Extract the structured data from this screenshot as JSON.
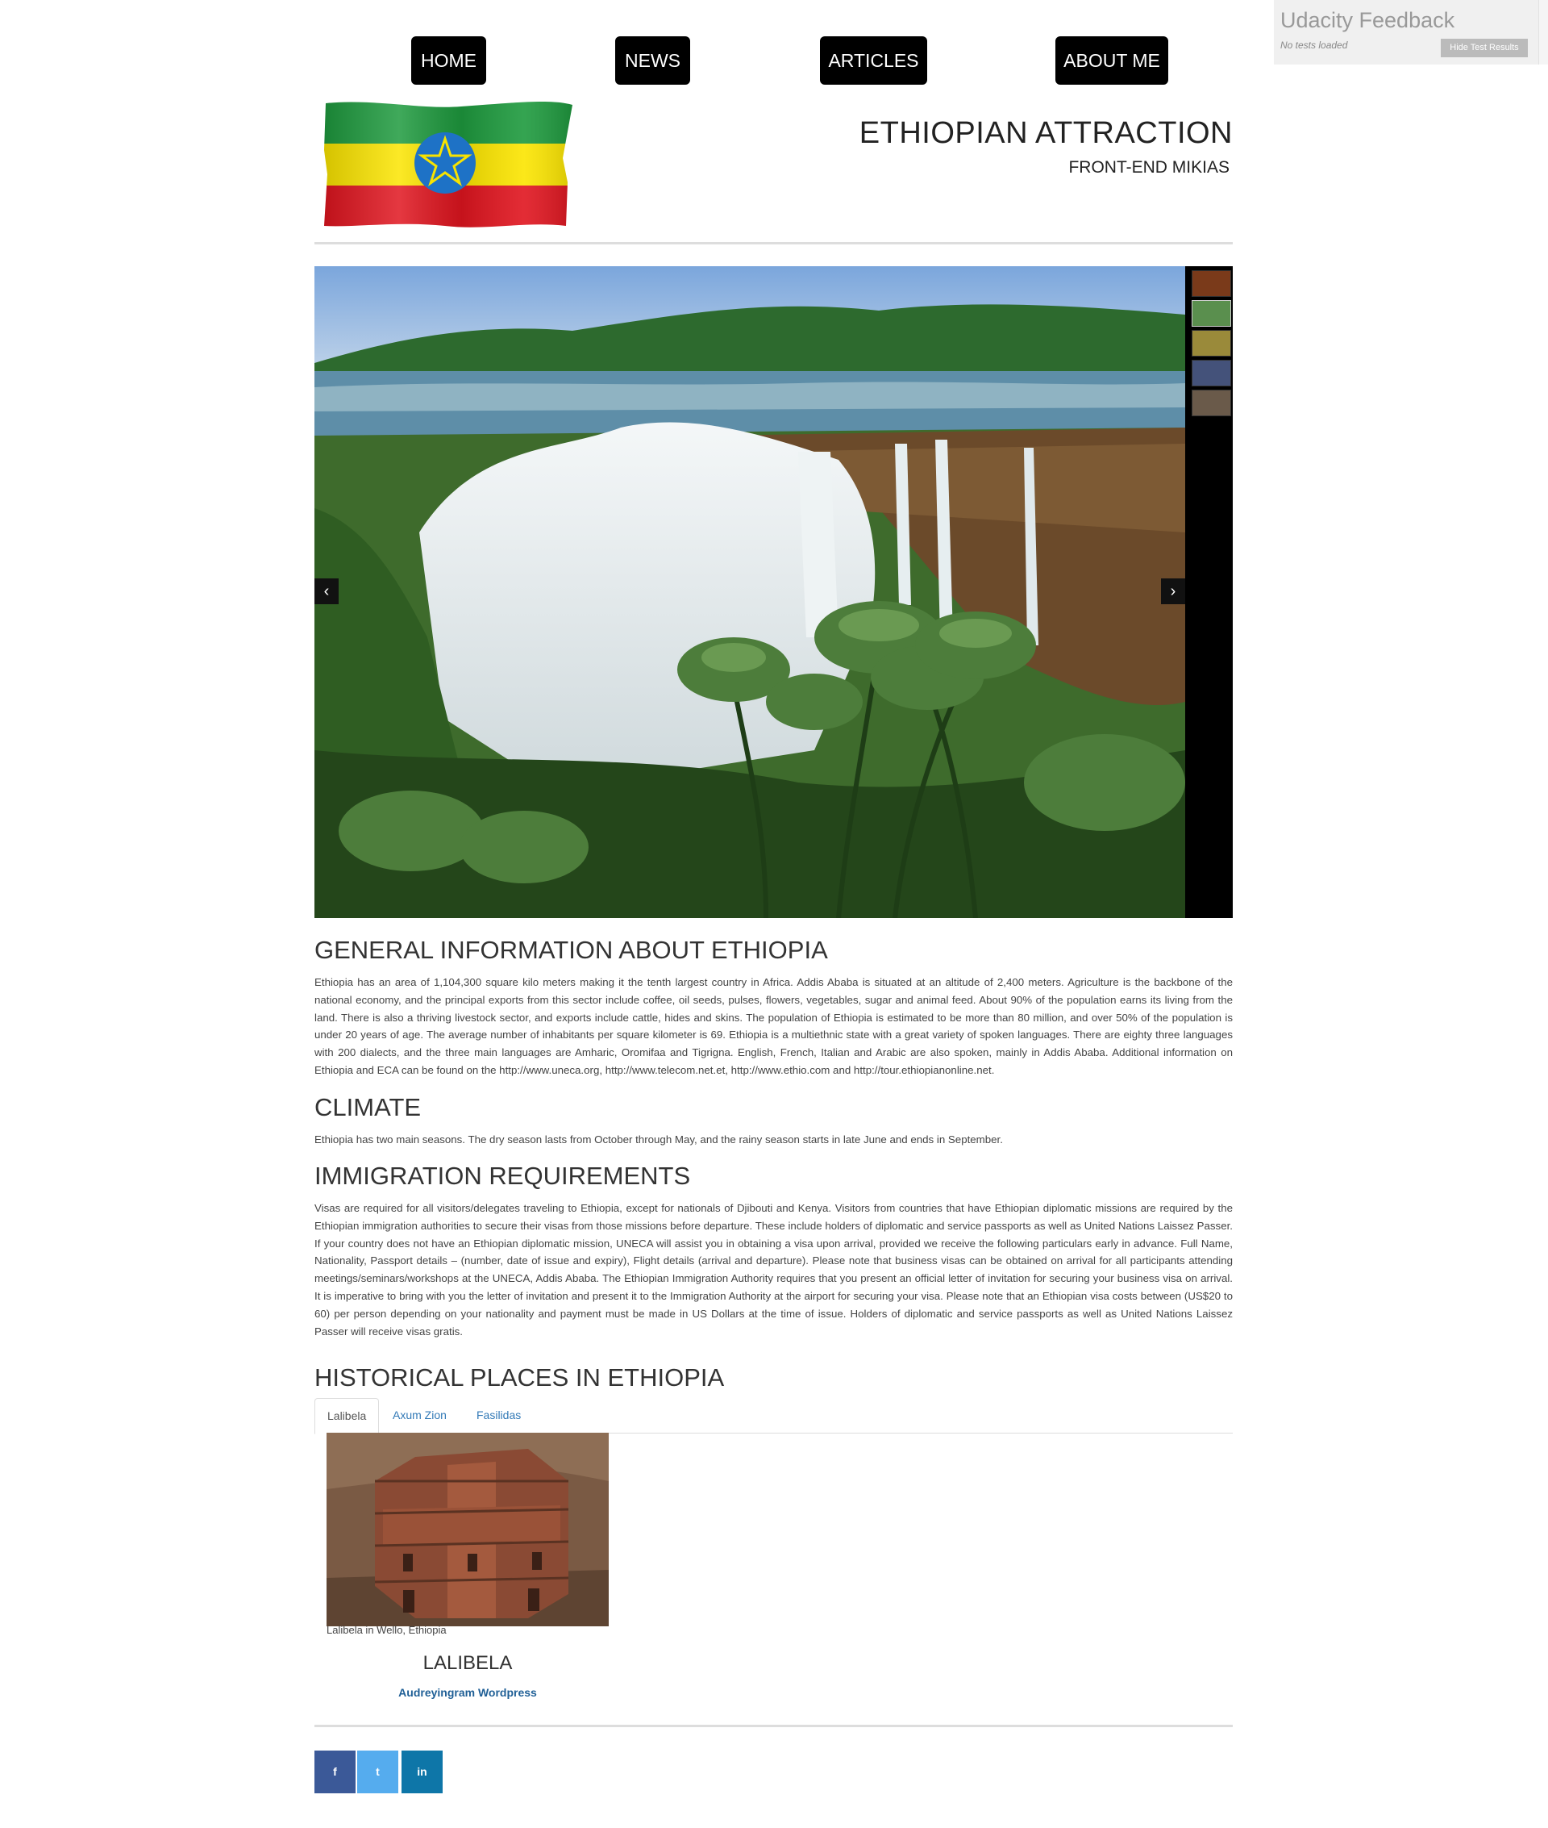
{
  "nav": {
    "items": [
      {
        "label": "HOME"
      },
      {
        "label": "NEWS"
      },
      {
        "label": "ARTICLES"
      },
      {
        "label": "ABOUT ME"
      }
    ]
  },
  "header": {
    "title": "ETHIOPIAN ATTRACTION",
    "subtitle": "FRONT-END MIKIAS"
  },
  "carousel": {
    "prev_icon": "‹",
    "next_icon": "›"
  },
  "sections": {
    "general": {
      "heading": "GENERAL INFORMATION ABOUT ETHIOPIA",
      "text": "Ethiopia has an area of 1,104,300 square kilo meters making it the tenth largest country in Africa. Addis Ababa is situated at an altitude of 2,400 meters. Agriculture is the backbone of the national economy, and the principal exports from this sector include coffee, oil seeds, pulses, flowers, vegetables, sugar and animal feed. About 90% of the population earns its living from the land. There is also a thriving livestock sector, and exports include cattle, hides and skins. The population of Ethiopia is estimated to be more than 80 million, and over 50% of the population is under 20 years of age. The average number of inhabitants per square kilometer is 69. Ethiopia is a multiethnic state with a great variety of spoken languages. There are eighty three languages with 200 dialects, and the three main languages are Amharic, Oromifaa and Tigrigna. English, French, Italian and Arabic are also spoken, mainly in Addis Ababa. Additional information on Ethiopia and ECA can be found on the http://www.uneca.org, http://www.telecom.net.et, http://www.ethio.com and http://tour.ethiopianonline.net."
    },
    "climate": {
      "heading": "CLIMATE",
      "text": "Ethiopia has two main seasons. The dry season lasts from October through May, and the rainy season starts in late June and ends in September."
    },
    "immigration": {
      "heading": "IMMIGRATION REQUIREMENTS",
      "text": "Visas are required for all visitors/delegates traveling to Ethiopia, except for nationals of Djibouti and Kenya. Visitors from countries that have Ethiopian diplomatic missions are required by the Ethiopian immigration authorities to secure their visas from those missions before departure. These include holders of diplomatic and service passports as well as United Nations Laissez Passer. If your country does not have an Ethiopian diplomatic mission, UNECA will assist you in obtaining a visa upon arrival, provided we receive the following particulars early in advance. Full Name, Nationality, Passport details – (number, date of issue and expiry), Flight details (arrival and departure). Please note that business visas can be obtained on arrival for all participants attending meetings/seminars/workshops at the UNECA, Addis Ababa. The Ethiopian Immigration Authority requires that you present an official letter of invitation for securing your business visa on arrival. It is imperative to bring with you the letter of invitation and present it to the Immigration Authority at the airport for securing your visa. Please note that an Ethiopian visa costs between (US$20 to 60) per person depending on your nationality and payment must be made in US Dollars at the time of issue. Holders of diplomatic and service passports as well as United Nations Laissez Passer will receive visas gratis."
    },
    "historical": {
      "heading": "HISTORICAL PLACES IN ETHIOPIA"
    }
  },
  "tabs": [
    {
      "label": "Lalibela"
    },
    {
      "label": "Axum Zion"
    },
    {
      "label": "Fasilidas"
    }
  ],
  "place": {
    "caption": "Lalibela in Wello, Ethiopia",
    "title": "LALIBELA",
    "link": "Audreyingram Wordpress"
  },
  "social": [
    {
      "icon": "facebook-icon",
      "glyph": "f",
      "color": "#3b5998"
    },
    {
      "icon": "twitter-icon",
      "glyph": "t",
      "color": "#55acee"
    },
    {
      "icon": "linkedin-icon",
      "glyph": "in",
      "color": "#0e76a8"
    }
  ],
  "udacity": {
    "title": "Udacity Feedback",
    "status": "No tests loaded",
    "button": "Hide Test Results"
  }
}
